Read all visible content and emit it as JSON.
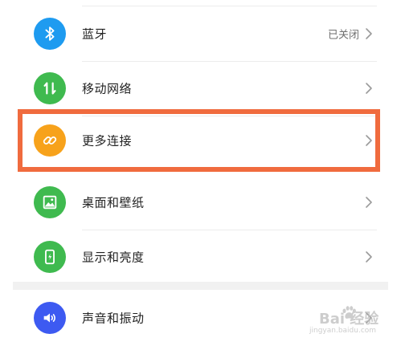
{
  "settings": {
    "items": [
      {
        "id": "bluetooth",
        "label": "蓝牙",
        "value": "已关闭",
        "icon": "bluetooth-icon",
        "icon_bg": "#1e9bf0"
      },
      {
        "id": "mobile-network",
        "label": "移动网络",
        "value": "",
        "icon": "mobile-data-icon",
        "icon_bg": "#3fba4f"
      },
      {
        "id": "more-connections",
        "label": "更多连接",
        "value": "",
        "icon": "link-icon",
        "icon_bg": "#f7a21b"
      },
      {
        "id": "desktop-wallpaper",
        "label": "桌面和壁纸",
        "value": "",
        "icon": "picture-icon",
        "icon_bg": "#3fba4f"
      },
      {
        "id": "display-brightness",
        "label": "显示和亮度",
        "value": "",
        "icon": "phone-brightness-icon",
        "icon_bg": "#3fba4f"
      },
      {
        "id": "sound-vibration",
        "label": "声音和振动",
        "value": "",
        "icon": "speaker-icon",
        "icon_bg": "#3d5af1"
      }
    ]
  },
  "highlight": {
    "color": "#f06b3e",
    "target": "more-connections"
  },
  "watermark": {
    "brand": "Bai 经验",
    "url": "jingyan.baidu.com"
  }
}
